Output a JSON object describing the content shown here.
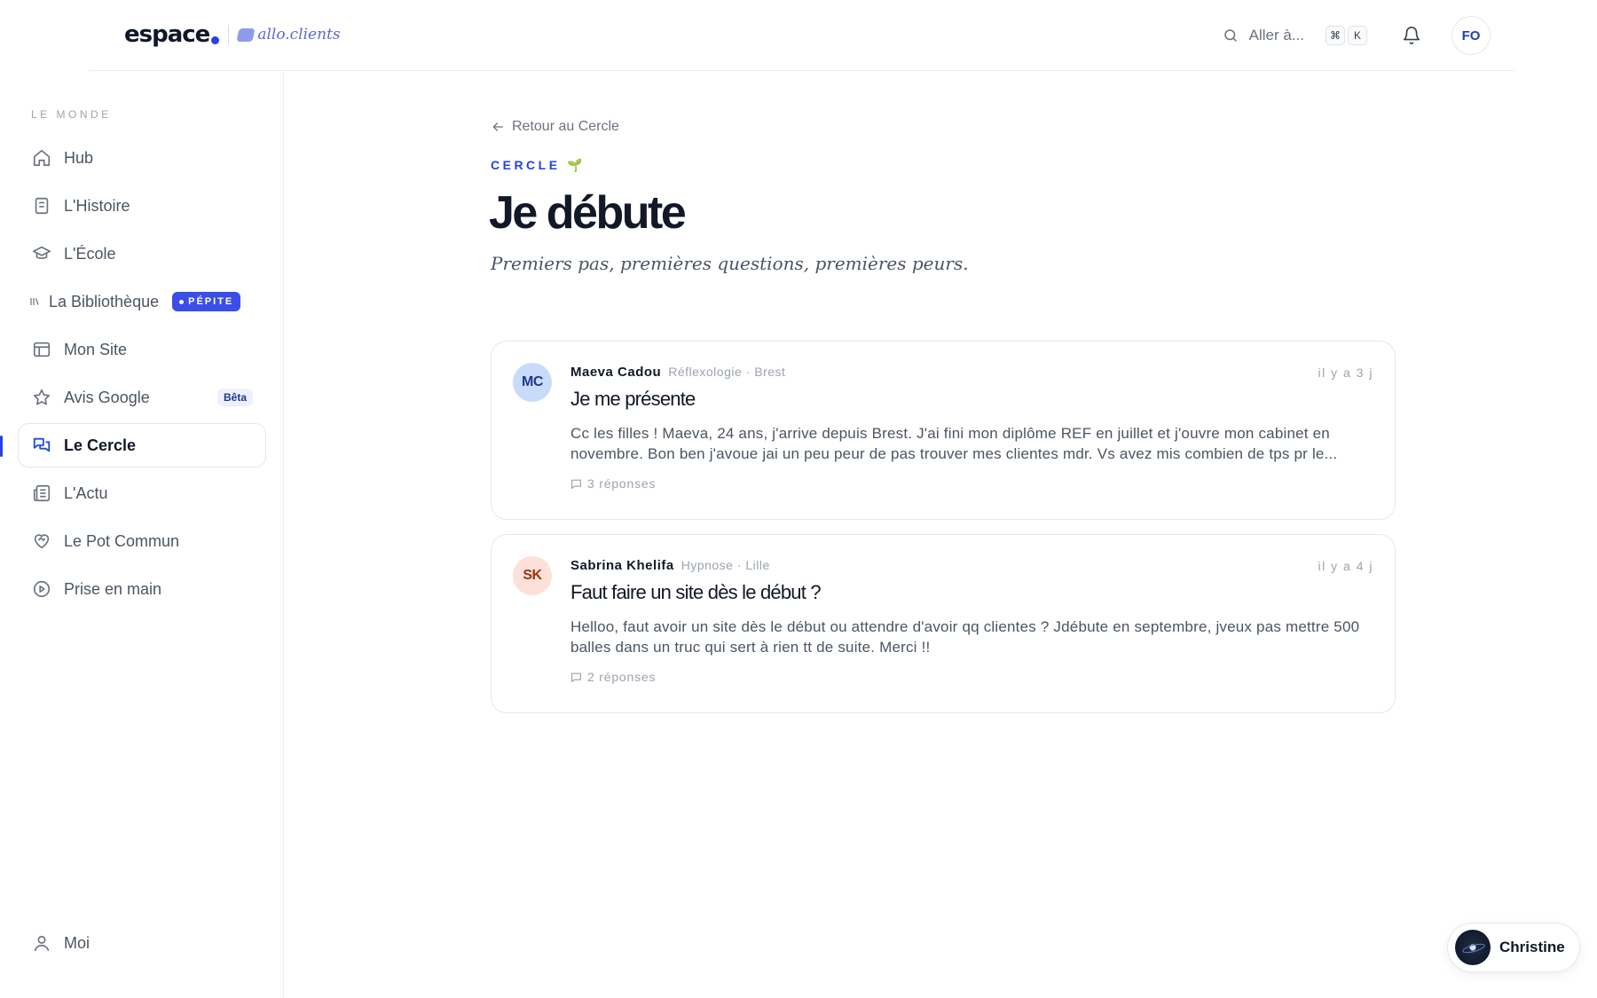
{
  "header": {
    "logo_main": "espace",
    "logo_secondary": "allo.clients",
    "search_label": "Aller à...",
    "shortcut_keys": [
      "⌘",
      "K"
    ],
    "user_initials": "FO"
  },
  "sidebar": {
    "section_label": "LE MONDE",
    "items": [
      {
        "label": "Hub",
        "icon": "home-icon"
      },
      {
        "label": "L'Histoire",
        "icon": "book-icon"
      },
      {
        "label": "L'École",
        "icon": "graduation-cap-icon"
      },
      {
        "label": "La Bibliothèque",
        "icon": "library-icon",
        "badge": "PÉPITE"
      },
      {
        "label": "Mon Site",
        "icon": "layout-icon"
      },
      {
        "label": "Avis Google",
        "icon": "star-icon",
        "badge": "Bêta"
      },
      {
        "label": "Le Cercle",
        "icon": "chat-icon",
        "active": true
      },
      {
        "label": "L'Actu",
        "icon": "newspaper-icon"
      },
      {
        "label": "Le Pot Commun",
        "icon": "heart-handshake-icon"
      },
      {
        "label": "Prise en main",
        "icon": "play-circle-icon"
      }
    ],
    "bottom_item": {
      "label": "Moi",
      "icon": "user-icon"
    }
  },
  "main": {
    "back_label": "Retour au Cercle",
    "eyebrow": "CERCLE 🌱",
    "title": "Je débute",
    "subtitle": "Premiers pas, premières questions, premières peurs.",
    "posts": [
      {
        "initials": "MC",
        "avatar_bg": "#c9dbfb",
        "avatar_color": "#1e3a8a",
        "author": "Maeva Cadou",
        "meta": "Réflexologie · Brest",
        "time": "il y a 3 j",
        "title": "Je me présente",
        "body": "Cc les filles ! Maeva, 24 ans, j'arrive depuis Brest. J'ai fini mon diplôme REF en juillet et j'ouvre mon cabinet en novembre. Bon ben j'avoue jai un peu peur de pas trouver mes clientes mdr. Vs avez mis combien de tps pr le...",
        "replies": "3 réponses"
      },
      {
        "initials": "SK",
        "avatar_bg": "#fde0d8",
        "avatar_color": "#9a3412",
        "author": "Sabrina Khelifa",
        "meta": "Hypnose · Lille",
        "time": "il y a 4 j",
        "title": "Faut faire un site dès le début ?",
        "body": "Helloo, faut avoir un site dès le début ou attendre d'avoir qq clientes ? Jdébute en septembre, jveux pas mettre 500 balles dans un truc qui sert à rien tt de suite. Merci !!",
        "replies": "2 réponses"
      }
    ]
  },
  "assistant": {
    "name": "Christine"
  },
  "colors": {
    "accent": "#2442e6",
    "badge": "#3b4ee8"
  }
}
